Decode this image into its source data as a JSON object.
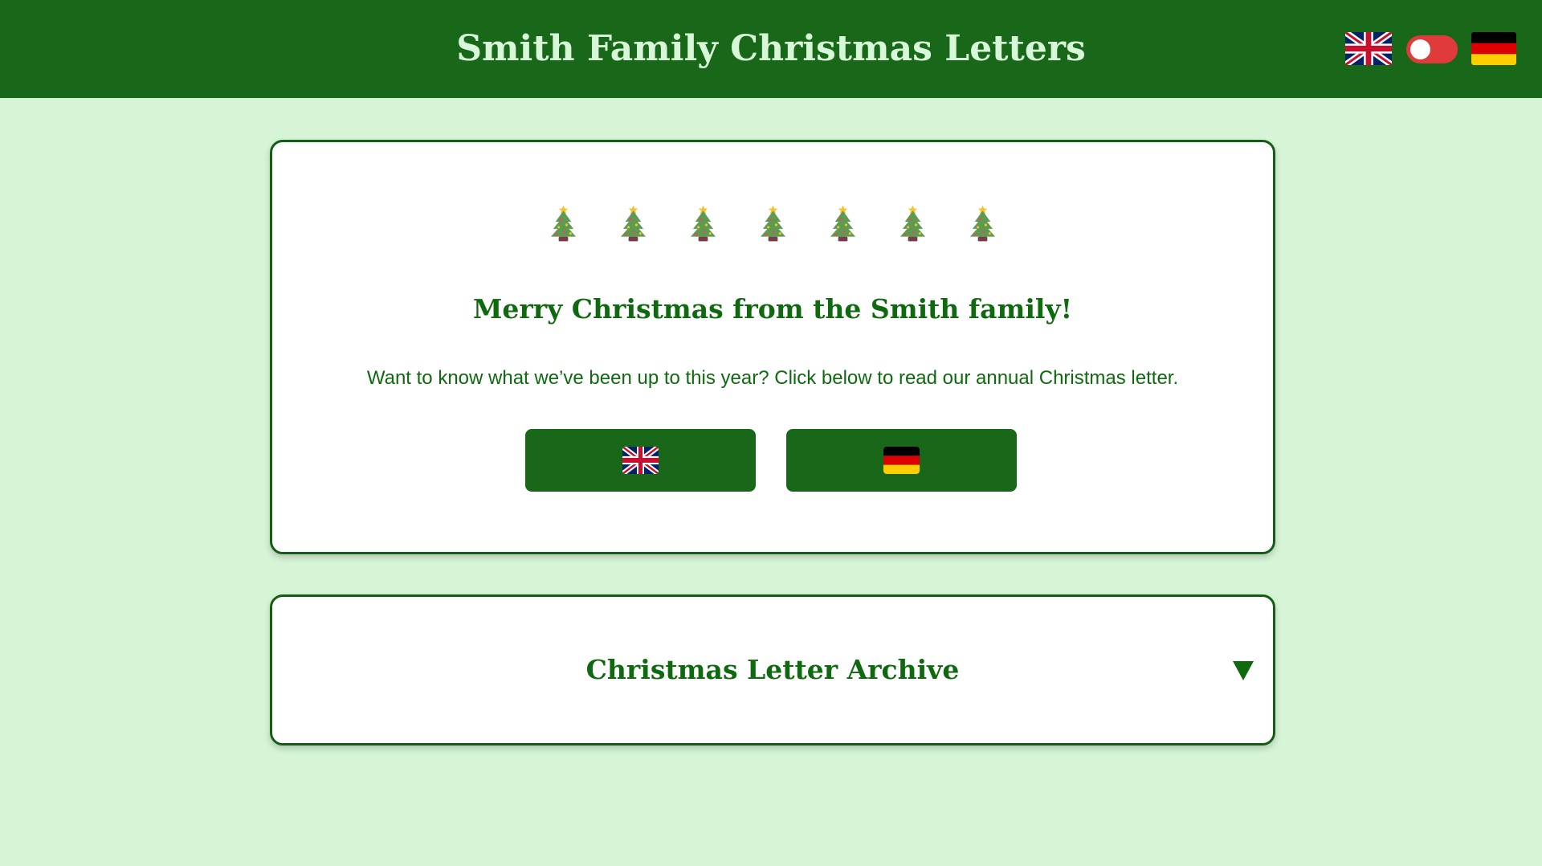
{
  "header": {
    "title": "Smith Family Christmas Letters",
    "language_flags": [
      "uk-flag-icon",
      "germany-flag-icon"
    ],
    "language_toggle": {
      "state": "off"
    }
  },
  "main_card": {
    "decoration": {
      "icon": "christmas-tree-icon",
      "count": 7
    },
    "heading": "Merry Christmas from the Smith family!",
    "intro": "Want to know what we’ve been up to this year? Click below to read our annual Christmas letter.",
    "buttons": [
      {
        "icon": "uk-flag-icon"
      },
      {
        "icon": "germany-flag-icon"
      }
    ]
  },
  "archive": {
    "title": "Christmas Letter Archive",
    "toggle_icon": "triangle-down-icon"
  },
  "colors": {
    "page_background": "#d6f4d6",
    "header_background": "#196819",
    "header_text": "#d8f6d8",
    "accent_green": "#0f6a0f",
    "button_green": "#196819",
    "toggle_red": "#e03b3b",
    "card_border": "#155d15"
  }
}
